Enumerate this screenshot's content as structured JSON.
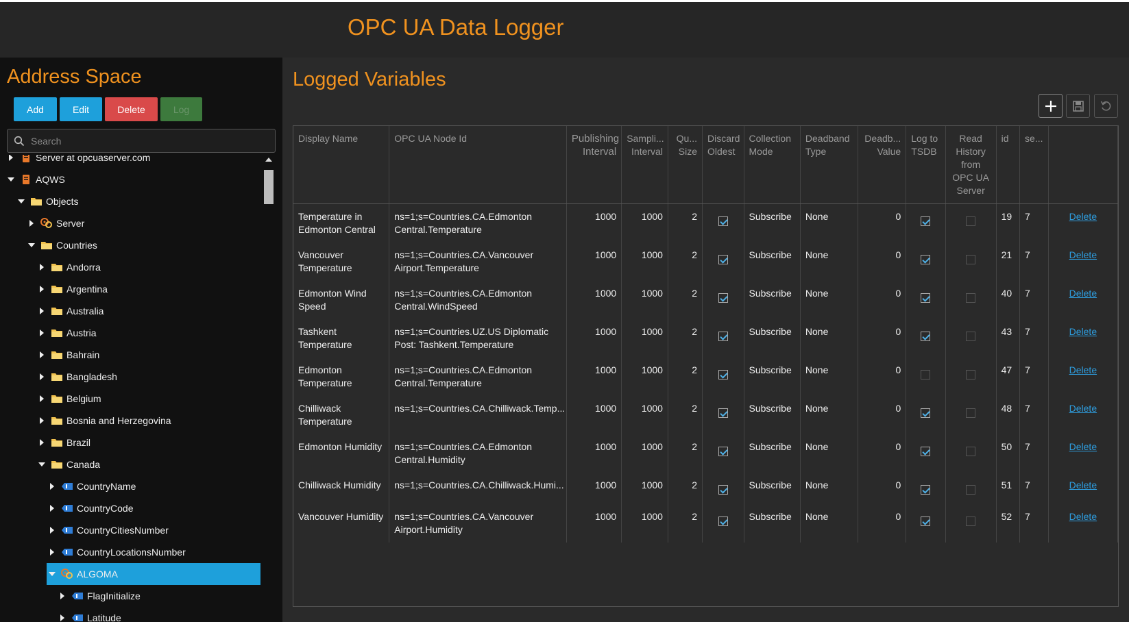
{
  "app": {
    "title": "OPC UA Data Logger"
  },
  "sidebar": {
    "title": "Address Space",
    "buttons": {
      "add": "Add",
      "edit": "Edit",
      "delete": "Delete",
      "log": "Log"
    },
    "search_placeholder": "Search",
    "tree": [
      {
        "label": "Server at opcuaserver.com",
        "icon": "server-icon",
        "level": 0,
        "expanded": false
      },
      {
        "label": "AQWS",
        "icon": "server-icon",
        "level": 0,
        "expanded": true
      },
      {
        "label": "Objects",
        "icon": "folder-icon",
        "level": 1,
        "expanded": true
      },
      {
        "label": "Server",
        "icon": "object-icon",
        "level": 2,
        "expanded": false
      },
      {
        "label": "Countries",
        "icon": "folder-icon",
        "level": 2,
        "expanded": true
      },
      {
        "label": "Andorra",
        "icon": "folder-icon",
        "level": 3,
        "expanded": false
      },
      {
        "label": "Argentina",
        "icon": "folder-icon",
        "level": 3,
        "expanded": false
      },
      {
        "label": "Australia",
        "icon": "folder-icon",
        "level": 3,
        "expanded": false
      },
      {
        "label": "Austria",
        "icon": "folder-icon",
        "level": 3,
        "expanded": false
      },
      {
        "label": "Bahrain",
        "icon": "folder-icon",
        "level": 3,
        "expanded": false
      },
      {
        "label": "Bangladesh",
        "icon": "folder-icon",
        "level": 3,
        "expanded": false
      },
      {
        "label": "Belgium",
        "icon": "folder-icon",
        "level": 3,
        "expanded": false
      },
      {
        "label": "Bosnia and Herzegovina",
        "icon": "folder-icon",
        "level": 3,
        "expanded": false
      },
      {
        "label": "Brazil",
        "icon": "folder-icon",
        "level": 3,
        "expanded": false
      },
      {
        "label": "Canada",
        "icon": "folder-icon",
        "level": 3,
        "expanded": true
      },
      {
        "label": "CountryName",
        "icon": "variable-icon",
        "level": 4,
        "expanded": false
      },
      {
        "label": "CountryCode",
        "icon": "variable-icon",
        "level": 4,
        "expanded": false
      },
      {
        "label": "CountryCitiesNumber",
        "icon": "variable-icon",
        "level": 4,
        "expanded": false
      },
      {
        "label": "CountryLocationsNumber",
        "icon": "variable-icon",
        "level": 4,
        "expanded": false
      },
      {
        "label": "ALGOMA",
        "icon": "object-icon",
        "level": 4,
        "expanded": true,
        "selected": true
      },
      {
        "label": "FlagInitialize",
        "icon": "variable-icon",
        "level": 5,
        "expanded": false
      },
      {
        "label": "Latitude",
        "icon": "variable-icon",
        "level": 5,
        "expanded": false
      }
    ]
  },
  "main": {
    "title": "Logged Variables",
    "columns": [
      "Display Name",
      "OPC UA Node Id",
      "Publishing Interval",
      "Sampli... Interval",
      "Qu... Size",
      "Discard Oldest",
      "Collection Mode",
      "Deadband Type",
      "Deadb... Value",
      "Log to TSDB",
      "Read History from OPC UA Server",
      "id",
      "se...",
      ""
    ],
    "rows": [
      {
        "name": "Temperature in Edmonton Central",
        "node": "ns=1;s=Countries.CA.Edmonton Central.Temperature",
        "pub": "1000",
        "samp": "1000",
        "queue": "2",
        "discard": true,
        "mode": "Subscribe",
        "dbtype": "None",
        "dbval": "0",
        "tsdb": true,
        "history": false,
        "id": "19",
        "se": "7",
        "action": "Delete"
      },
      {
        "name": "Vancouver Temperature",
        "node": "ns=1;s=Countries.CA.Vancouver Airport.Temperature",
        "pub": "1000",
        "samp": "1000",
        "queue": "2",
        "discard": true,
        "mode": "Subscribe",
        "dbtype": "None",
        "dbval": "0",
        "tsdb": true,
        "history": false,
        "id": "21",
        "se": "7",
        "action": "Delete"
      },
      {
        "name": "Edmonton Wind Speed",
        "node": "ns=1;s=Countries.CA.Edmonton Central.WindSpeed",
        "pub": "1000",
        "samp": "1000",
        "queue": "2",
        "discard": true,
        "mode": "Subscribe",
        "dbtype": "None",
        "dbval": "0",
        "tsdb": true,
        "history": false,
        "id": "40",
        "se": "7",
        "action": "Delete"
      },
      {
        "name": "Tashkent Temperature",
        "node": "ns=1;s=Countries.UZ.US Diplomatic Post: Tashkent.Temperature",
        "pub": "1000",
        "samp": "1000",
        "queue": "2",
        "discard": true,
        "mode": "Subscribe",
        "dbtype": "None",
        "dbval": "0",
        "tsdb": true,
        "history": false,
        "id": "43",
        "se": "7",
        "action": "Delete"
      },
      {
        "name": "Edmonton Temperature",
        "node": "ns=1;s=Countries.CA.Edmonton Central.Temperature",
        "pub": "1000",
        "samp": "1000",
        "queue": "2",
        "discard": true,
        "mode": "Subscribe",
        "dbtype": "None",
        "dbval": "0",
        "tsdb": false,
        "history": false,
        "id": "47",
        "se": "7",
        "action": "Delete"
      },
      {
        "name": "Chilliwack Temperature",
        "node": "ns=1;s=Countries.CA.Chilliwack.Temp...",
        "pub": "1000",
        "samp": "1000",
        "queue": "2",
        "discard": true,
        "mode": "Subscribe",
        "dbtype": "None",
        "dbval": "0",
        "tsdb": true,
        "history": false,
        "id": "48",
        "se": "7",
        "action": "Delete"
      },
      {
        "name": "Edmonton Humidity",
        "node": "ns=1;s=Countries.CA.Edmonton Central.Humidity",
        "pub": "1000",
        "samp": "1000",
        "queue": "2",
        "discard": true,
        "mode": "Subscribe",
        "dbtype": "None",
        "dbval": "0",
        "tsdb": true,
        "history": false,
        "id": "50",
        "se": "7",
        "action": "Delete"
      },
      {
        "name": "Chilliwack Humidity",
        "node": "ns=1;s=Countries.CA.Chilliwack.Humi...",
        "pub": "1000",
        "samp": "1000",
        "queue": "2",
        "discard": true,
        "mode": "Subscribe",
        "dbtype": "None",
        "dbval": "0",
        "tsdb": true,
        "history": false,
        "id": "51",
        "se": "7",
        "action": "Delete",
        "single": true
      },
      {
        "name": "Vancouver Humidity",
        "node": "ns=1;s=Countries.CA.Vancouver Airport.Humidity",
        "pub": "1000",
        "samp": "1000",
        "queue": "2",
        "discard": true,
        "mode": "Subscribe",
        "dbtype": "None",
        "dbval": "0",
        "tsdb": true,
        "history": false,
        "id": "52",
        "se": "7",
        "action": "Delete"
      }
    ]
  },
  "colors": {
    "accent": "#f0921f",
    "primary_button": "#1ea0db",
    "danger_button": "#d94a4a",
    "log_button": "#3d7a3d",
    "selection": "#1ea0db",
    "link": "#2e9ee0"
  }
}
